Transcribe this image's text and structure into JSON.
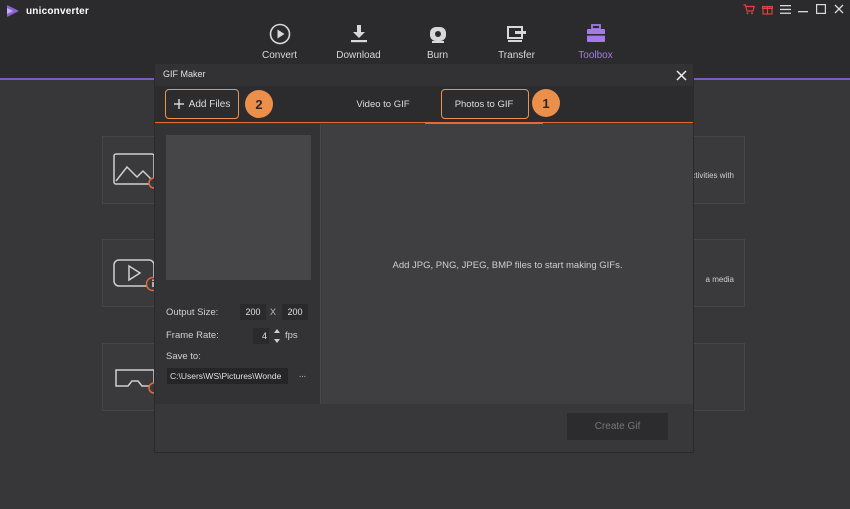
{
  "app": {
    "name": "uniconverter"
  },
  "nav": {
    "items": [
      {
        "label": "Convert",
        "icon": "convert-icon"
      },
      {
        "label": "Download",
        "icon": "download-icon"
      },
      {
        "label": "Burn",
        "icon": "burn-icon"
      },
      {
        "label": "Transfer",
        "icon": "transfer-icon"
      },
      {
        "label": "Toolbox",
        "icon": "toolbox-icon",
        "active": true
      }
    ]
  },
  "background_cards": [
    {
      "text": "ctivities with"
    },
    {
      "text": "a media"
    },
    {
      "text": ""
    }
  ],
  "modal": {
    "title": "GIF Maker",
    "add_files_label": "Add Files",
    "tabs": [
      {
        "label": "Video to GIF"
      },
      {
        "label": "Photos to GIF",
        "active": true
      }
    ],
    "markers": [
      "1",
      "2"
    ],
    "settings": {
      "output_size_label": "Output Size:",
      "width": "200",
      "x_label": "X",
      "height": "200",
      "frame_rate_label": "Frame Rate:",
      "frame_rate": "4",
      "fps_label": "fps",
      "save_to_label": "Save to:",
      "save_path": "C:\\Users\\WS\\Pictures\\Wonde",
      "browse_label": "···"
    },
    "hint": "Add JPG, PNG, JPEG, BMP files to start making GIFs.",
    "create_button": "Create Gif"
  },
  "colors": {
    "accent_purple": "#7b5cc4",
    "active_nav": "#a27be8",
    "highlight_orange": "#f0914a",
    "tab_underline": "#e06a3a",
    "cart_red": "#e0453a"
  }
}
